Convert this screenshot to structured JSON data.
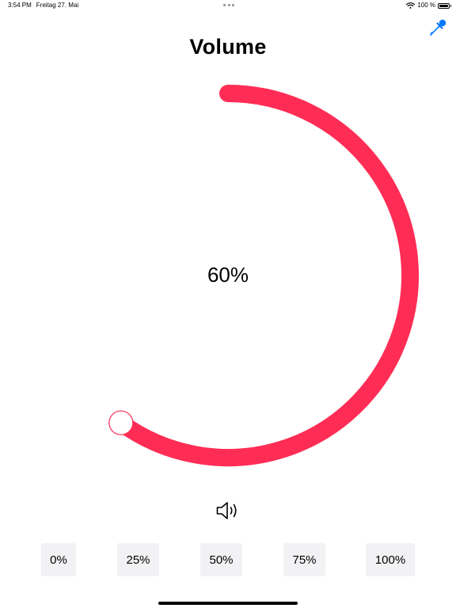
{
  "status_bar": {
    "time": "3:54 PM",
    "date": "Freitag 27. Mai",
    "battery": "100 %"
  },
  "title": "Volume",
  "dial": {
    "value_label": "60%",
    "value_fraction": 0.6,
    "color": "#ff2d55"
  },
  "presets": [
    "0%",
    "25%",
    "50%",
    "75%",
    "100%"
  ],
  "icons": {
    "top_right": "eyedropper-icon",
    "speaker": "speaker-icon",
    "wifi": "wifi-icon",
    "battery": "battery-icon"
  },
  "colors": {
    "accent_blue": "#0a7aff",
    "button_bg": "#f2f2f4"
  }
}
